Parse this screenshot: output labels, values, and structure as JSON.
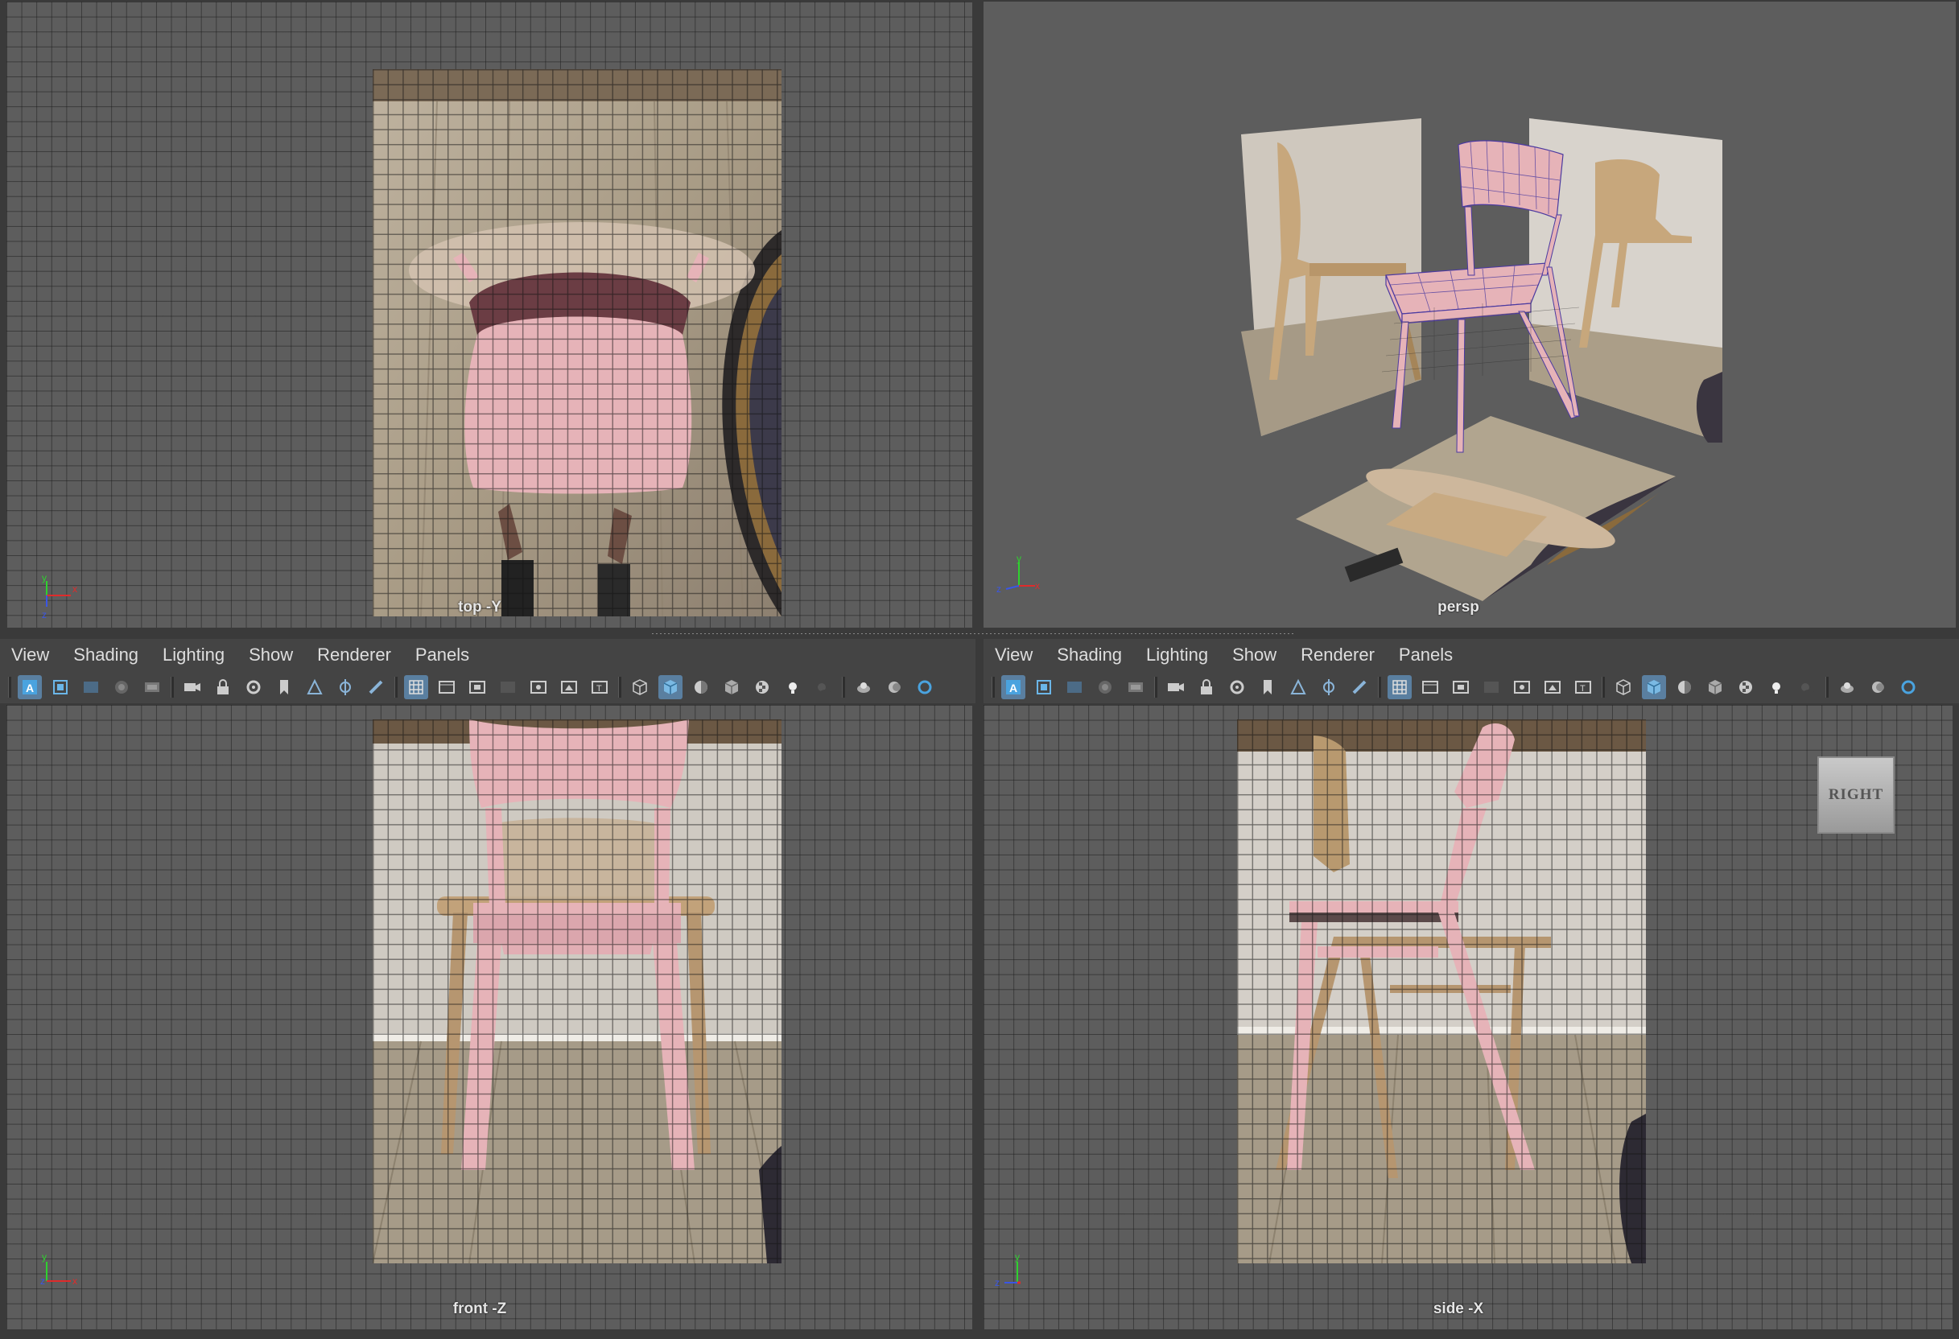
{
  "menus": [
    "View",
    "Shading",
    "Lighting",
    "Show",
    "Renderer",
    "Panels"
  ],
  "viewports": {
    "top": {
      "label": "top -Y"
    },
    "persp": {
      "label": "persp"
    },
    "front": {
      "label": "front -Z"
    },
    "side": {
      "label": "side -X"
    }
  },
  "viewcube": {
    "face": "RIGHT"
  },
  "toolbar_icons": [
    "select-camera-icon",
    "camera-attributes-icon",
    "image-plane-icon",
    "film-gate-icon",
    "resolution-gate-icon",
    "camera-icon",
    "lock-camera-icon",
    "camera-settings-icon",
    "bookmark-icon",
    "two-d-pan-icon",
    "grease-pencil-icon",
    "paint-icon",
    "grid-icon",
    "film-gate-toggle-icon",
    "resolution-gate-toggle-icon",
    "gate-mask-icon",
    "field-chart-icon",
    "safe-action-icon",
    "safe-title-icon",
    "wireframe-icon",
    "smooth-shade-icon",
    "shaded-wireframe-icon",
    "textured-icon",
    "checker-icon",
    "lights-icon",
    "shadows-icon",
    "screen-space-ao-icon",
    "motion-blur-icon",
    "anti-aliasing-icon"
  ],
  "colors": {
    "panel_bg": "#5d5d5d",
    "menubar_bg": "#444444",
    "chair_pink": "#e6b3b8",
    "axis_x": "#e02b2b",
    "axis_y": "#2fd12f",
    "axis_z": "#3a56e6",
    "active_button": "#5a7fa0"
  }
}
